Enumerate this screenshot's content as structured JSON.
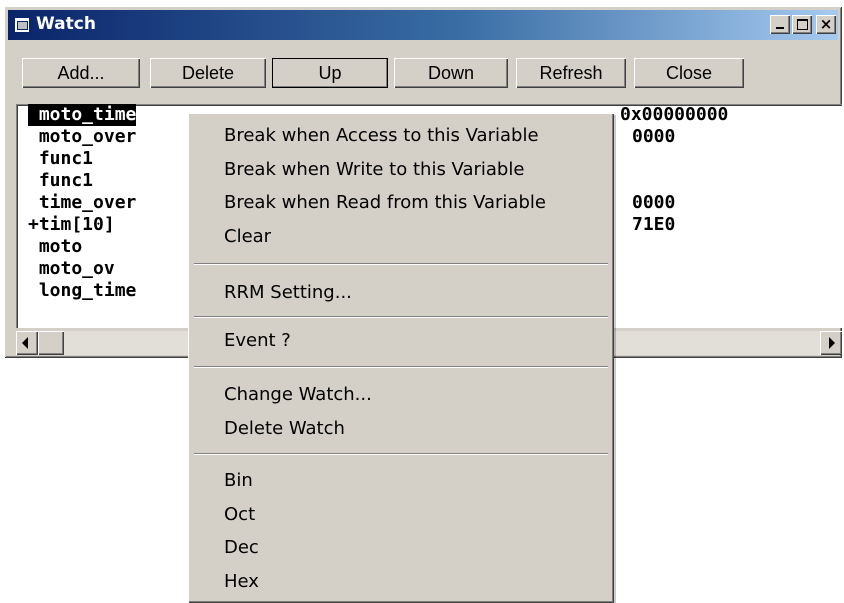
{
  "window": {
    "title": "Watch"
  },
  "toolbar": {
    "add": "Add...",
    "delete": "Delete",
    "up": "Up",
    "down": "Down",
    "refresh": "Refresh",
    "close": "Close"
  },
  "watch_list": {
    "rows": [
      {
        "name": " moto_time",
        "value": "0x00000000",
        "selected": true
      },
      {
        "name": " moto_over",
        "value": "0x00000000"
      },
      {
        "name": " func1",
        "value": ""
      },
      {
        "name": " func1",
        "value": ""
      },
      {
        "name": " time_over",
        "value": "0x00000000"
      },
      {
        "name": "+tim[10]",
        "value": "0x000071E0"
      },
      {
        "name": " moto",
        "value": ""
      },
      {
        "name": " moto_ov",
        "value": ""
      },
      {
        "name": " long_time",
        "value": ""
      }
    ],
    "visible_values": [
      "0x00000000",
      "0000",
      "0000",
      "71E0"
    ]
  },
  "context_menu": {
    "items": [
      "Break when Access to this Variable",
      "Break when Write to this Variable",
      "Break when Read from this Variable",
      "Clear",
      "RRM Setting...",
      "Event ?",
      "Change Watch...",
      "Delete Watch",
      "Bin",
      "Oct",
      "Dec",
      "Hex"
    ]
  },
  "icons": {
    "window": "window-icon",
    "minimize": "minimize-icon",
    "maximize": "maximize-icon",
    "close": "close-icon",
    "scroll_left": "arrow-left-icon",
    "scroll_right": "arrow-right-icon"
  },
  "colors": {
    "titlebar_start": "#0a246a",
    "titlebar_end": "#a6caf0",
    "face": "#d4d0c8",
    "selection": "#000000"
  }
}
